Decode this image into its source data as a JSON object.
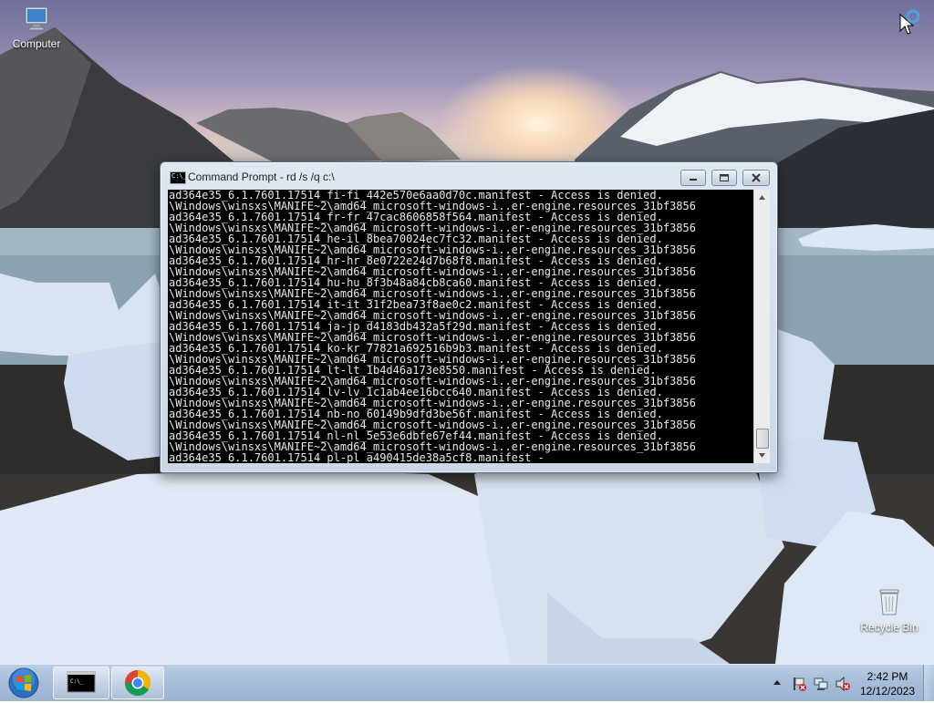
{
  "desktop": {
    "icons": [
      {
        "label": "Computer"
      },
      {
        "label": "Recycle Bin"
      }
    ]
  },
  "cmd_window": {
    "title": "Command Prompt - rd  /s /q c:\\",
    "buttons": {
      "minimize": "minimize-icon",
      "maximize": "maximize-icon",
      "close": "close-icon"
    },
    "console_lines": [
      "ad364e35_6.1.7601.17514_fi-fi_442e570e6aa0d70c.manifest - Access is denied.",
      "\\Windows\\winsxs\\MANIFE~2\\amd64_microsoft-windows-i..er-engine.resources_31bf3856",
      "ad364e35_6.1.7601.17514_fr-fr_47cac8606858f564.manifest - Access is denied.",
      "\\Windows\\winsxs\\MANIFE~2\\amd64_microsoft-windows-i..er-engine.resources_31bf3856",
      "ad364e35_6.1.7601.17514_he-il_8bea70024ec7fc32.manifest - Access is denied.",
      "\\Windows\\winsxs\\MANIFE~2\\amd64_microsoft-windows-i..er-engine.resources_31bf3856",
      "ad364e35_6.1.7601.17514_hr-hr_8e0722e24d7b68f8.manifest - Access is denied.",
      "\\Windows\\winsxs\\MANIFE~2\\amd64_microsoft-windows-i..er-engine.resources_31bf3856",
      "ad364e35_6.1.7601.17514_hu-hu_8f3b48a84cb8ca60.manifest - Access is denied.",
      "\\Windows\\winsxs\\MANIFE~2\\amd64_microsoft-windows-i..er-engine.resources_31bf3856",
      "ad364e35_6.1.7601.17514_it-it_31f2bea73f8ae0c2.manifest - Access is denied.",
      "\\Windows\\winsxs\\MANIFE~2\\amd64_microsoft-windows-i..er-engine.resources_31bf3856",
      "ad364e35_6.1.7601.17514_ja-jp_d4183db432a5f29d.manifest - Access is denied.",
      "\\Windows\\winsxs\\MANIFE~2\\amd64_microsoft-windows-i..er-engine.resources_31bf3856",
      "ad364e35_6.1.7601.17514_ko-kr_77821a692516b9b3.manifest - Access is denied.",
      "\\Windows\\winsxs\\MANIFE~2\\amd64_microsoft-windows-i..er-engine.resources_31bf3856",
      "ad364e35_6.1.7601.17514_lt-lt_1b4d46a173e8550.manifest - Access is denied.",
      "\\Windows\\winsxs\\MANIFE~2\\amd64_microsoft-windows-i..er-engine.resources_31bf3856",
      "ad364e35_6.1.7601.17514_lv-lv_1c1ab4ee16bcc640.manifest - Access is denied.",
      "\\Windows\\winsxs\\MANIFE~2\\amd64_microsoft-windows-i..er-engine.resources_31bf3856",
      "ad364e35_6.1.7601.17514_nb-no_60149b9dfd3be56f.manifest - Access is denied.",
      "\\Windows\\winsxs\\MANIFE~2\\amd64_microsoft-windows-i..er-engine.resources_31bf3856",
      "ad364e35_6.1.7601.17514_nl-nl_5e53e6dbfe67ef44.manifest - Access is denied.",
      "\\Windows\\winsxs\\MANIFE~2\\amd64_microsoft-windows-i..er-engine.resources_31bf3856",
      "ad364e35_6.1.7601.17514_pl-pl_a490415de38a5cf8.manifest -"
    ]
  },
  "taskbar": {
    "start_icon": "windows-start-orb-icon",
    "pinned": [
      {
        "name": "cmd",
        "icon": "command-prompt-icon"
      },
      {
        "name": "chrome",
        "icon": "chrome-icon"
      }
    ],
    "tray_icons": [
      "show-hidden-icons-chevron",
      "action-center-flag-icon",
      "network-icon",
      "volume-muted-icon"
    ],
    "clock": {
      "time": "2:42 PM",
      "date": "12/12/2023"
    }
  }
}
